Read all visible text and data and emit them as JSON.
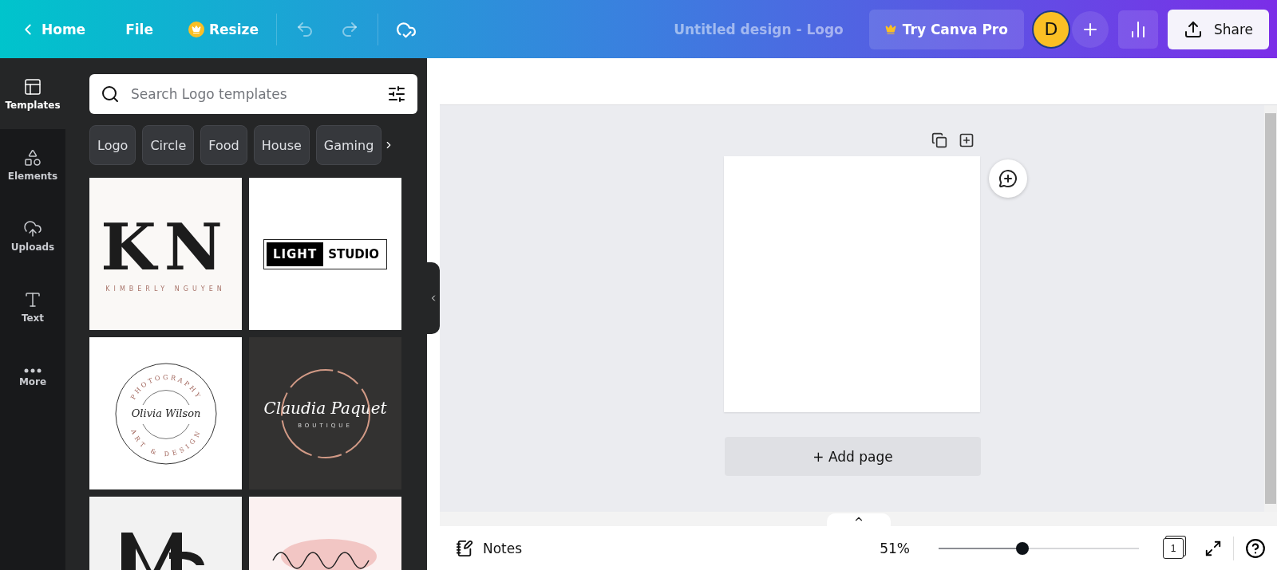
{
  "topbar": {
    "home": "Home",
    "file": "File",
    "resize": "Resize",
    "title": "Untitled design - Logo",
    "pro": "Try Canva Pro",
    "avatar": "D",
    "share": "Share"
  },
  "rail": [
    {
      "label": "Templates",
      "selected": true
    },
    {
      "label": "Elements",
      "selected": false
    },
    {
      "label": "Uploads",
      "selected": false
    },
    {
      "label": "Text",
      "selected": false
    },
    {
      "label": "More",
      "selected": false
    }
  ],
  "search": {
    "placeholder": "Search Logo templates"
  },
  "chips": [
    "Logo",
    "Circle",
    "Food",
    "House",
    "Gaming"
  ],
  "templates": [
    {
      "kind": "monogram",
      "letters": "KN",
      "subtitle": "KIMBERLY NGUYEN"
    },
    {
      "kind": "boxed",
      "left": "LIGHT",
      "right": "STUDIO"
    },
    {
      "kind": "badge",
      "top": "PHOTOGRAPHY",
      "name": "Olivia Wilson",
      "bottom": "ART & DESIGN"
    },
    {
      "kind": "script",
      "name": "Claudia Paquet",
      "subtitle": "BOUTIQUE"
    },
    {
      "kind": "partial-dark"
    },
    {
      "kind": "partial-pink"
    }
  ],
  "add_page": "+ Add page",
  "footer": {
    "notes": "Notes",
    "zoom": "51%",
    "level": 0.42,
    "pages": "1"
  }
}
